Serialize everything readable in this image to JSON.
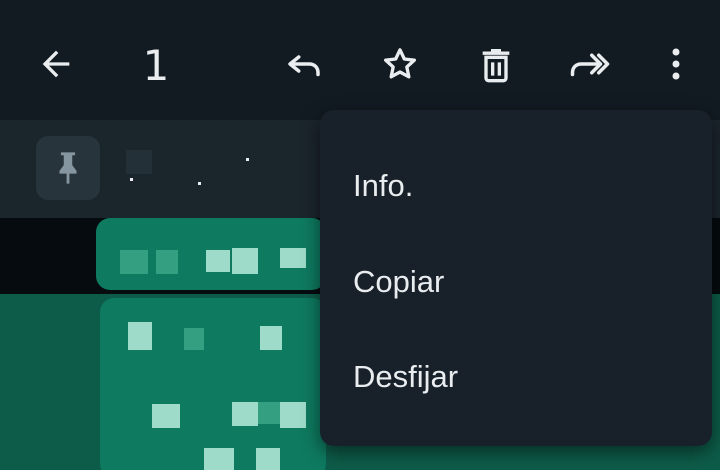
{
  "topbar": {
    "selected_count": "1",
    "icons": [
      "back-arrow-icon",
      "reply-icon",
      "star-icon",
      "delete-icon",
      "forward-icon",
      "more-vert-icon"
    ]
  },
  "pinned": {
    "icon": "pin-icon"
  },
  "menu": {
    "items": [
      {
        "label": "Info."
      },
      {
        "label": "Copiar"
      },
      {
        "label": "Desfijar"
      }
    ]
  },
  "colors": {
    "topbar_bg": "#121b22",
    "menu_bg": "#18202a",
    "text": "#e9edef",
    "chat_green": "#0e7a5f"
  }
}
